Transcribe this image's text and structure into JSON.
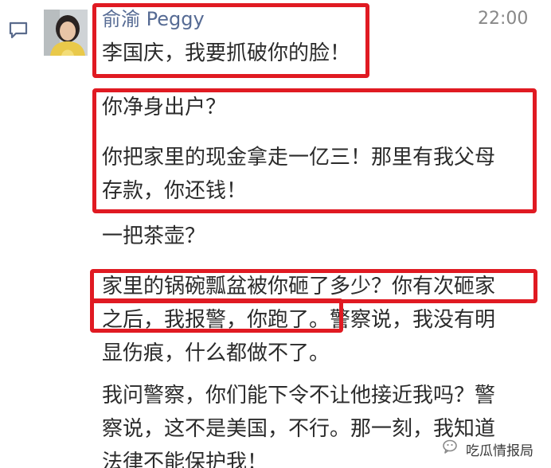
{
  "comment": {
    "author": "俞渝 Peggy",
    "time": "22:00",
    "avatar_alt": "avatar",
    "paragraphs": [
      {
        "lines": [
          "李国庆，我要抓破你的脸！"
        ]
      },
      {
        "lines": [
          "你净身出户？"
        ]
      },
      {
        "lines": [
          "你把家里的现金拿走一亿三！那里有我父母",
          "存款，你还钱！"
        ]
      },
      {
        "lines": [
          "一把茶壶？"
        ]
      },
      {
        "lines": [
          "家里的锅碗瓢盆被你砸了多少？你有次砸家",
          "之后，我报警，你跑了。警察说，我没有明",
          "显伤痕，什么都做不了。"
        ]
      },
      {
        "lines": [
          "我问警察，你们能下令不让他接近我吗？警",
          "察说，这不是美国，不行。那一刻，我知道",
          "法律不能保护我！"
        ]
      }
    ]
  },
  "watermark": {
    "text": "吃瓜情报局",
    "icon": "wechat-logo-icon"
  },
  "colors": {
    "author": "#566b94",
    "text": "#2b2b2b",
    "time": "#888888",
    "highlight": "#e01a22"
  }
}
